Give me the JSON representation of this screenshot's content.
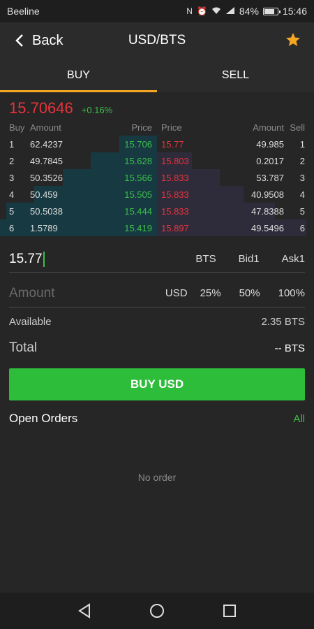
{
  "status_bar": {
    "carrier": "Beeline",
    "battery": "84%",
    "battery_level": 0.84,
    "time": "15:46"
  },
  "header": {
    "back_label": "Back",
    "title": "USD/BTS",
    "accent": "#f5a623"
  },
  "tabs": [
    {
      "label": "BUY",
      "active": true
    },
    {
      "label": "SELL",
      "active": false
    }
  ],
  "ticker": {
    "last_price": "15.70646",
    "change": "+0.16%"
  },
  "order_book": {
    "headers": {
      "buy": "Buy",
      "amount_left": "Amount",
      "price_left": "Price",
      "price_right": "Price",
      "amount_right": "Amount",
      "sell": "Sell"
    },
    "rows": [
      {
        "n": "1",
        "bid_amount": "62.4237",
        "bid_price": "15.706",
        "ask_price": "15.77",
        "ask_amount": "49.985",
        "bid_depth": 0.24,
        "ask_depth": 0.0
      },
      {
        "n": "2",
        "bid_amount": "49.7845",
        "bid_price": "15.628",
        "ask_price": "15.803",
        "ask_amount": "0.2017",
        "bid_depth": 0.42,
        "ask_depth": 0.22
      },
      {
        "n": "3",
        "bid_amount": "50.3526",
        "bid_price": "15.566",
        "ask_price": "15.833",
        "ask_amount": "53.787",
        "bid_depth": 0.6,
        "ask_depth": 0.4
      },
      {
        "n": "4",
        "bid_amount": "50.459",
        "bid_price": "15.505",
        "ask_price": "15.833",
        "ask_amount": "40.9508",
        "bid_depth": 0.78,
        "ask_depth": 0.55
      },
      {
        "n": "5",
        "bid_amount": "50.5038",
        "bid_price": "15.444",
        "ask_price": "15.833",
        "ask_amount": "47.8388",
        "bid_depth": 0.96,
        "ask_depth": 0.75
      },
      {
        "n": "6",
        "bid_amount": "1.5789",
        "bid_price": "15.419",
        "ask_price": "15.897",
        "ask_amount": "49.5496",
        "bid_depth": 1.0,
        "ask_depth": 0.95
      }
    ]
  },
  "price_input": {
    "value": "15.77",
    "unit": "BTS",
    "bid1": "Bid1",
    "ask1": "Ask1"
  },
  "amount_input": {
    "placeholder": "Amount",
    "unit": "USD",
    "pct25": "25%",
    "pct50": "50%",
    "pct100": "100%"
  },
  "available": {
    "label": "Available",
    "value": "2.35 BTS"
  },
  "total": {
    "label": "Total",
    "value": "-- BTS"
  },
  "buy_button": {
    "label": "BUY USD",
    "color": "#2ebd3a"
  },
  "open_orders": {
    "title": "Open Orders",
    "all_label": "All",
    "empty_text": "No order"
  }
}
